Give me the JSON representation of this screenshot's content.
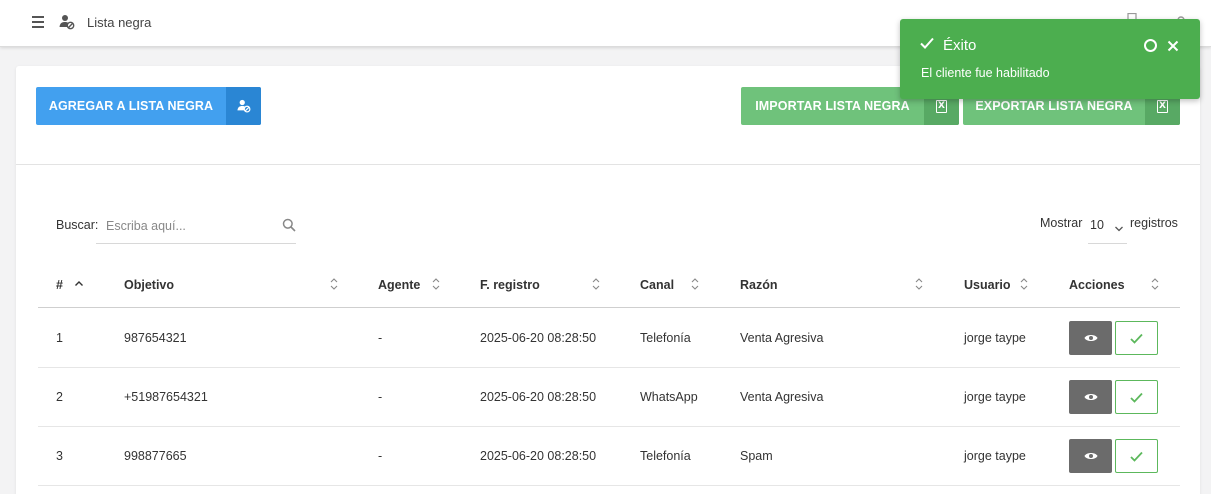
{
  "topbar": {
    "title": "Lista negra",
    "menu_icon": "hamburger-icon",
    "page_icon": "user-block-icon"
  },
  "toolbar": {
    "add_label": "AGREGAR A LISTA NEGRA",
    "import_label": "IMPORTAR LISTA NEGRA",
    "export_label": "EXPORTAR LISTA NEGRA",
    "excel_glyph": "X"
  },
  "search": {
    "label": "Buscar:",
    "placeholder": "Escriba aquí...",
    "value": ""
  },
  "length": {
    "prefix": "Mostrar",
    "value": "10",
    "suffix": "registros"
  },
  "table": {
    "columns": [
      "#",
      "Objetivo",
      "Agente",
      "F. registro",
      "Canal",
      "Razón",
      "Usuario",
      "Acciones"
    ],
    "rows": [
      {
        "n": "1",
        "objetivo": "987654321",
        "agente": "-",
        "fecha": "2025-06-20 08:28:50",
        "canal": "Telefonía",
        "razon": "Venta Agresiva",
        "usuario": "jorge taype"
      },
      {
        "n": "2",
        "objetivo": "+51987654321",
        "agente": "-",
        "fecha": "2025-06-20 08:28:50",
        "canal": "WhatsApp",
        "razon": "Venta Agresiva",
        "usuario": "jorge taype"
      },
      {
        "n": "3",
        "objetivo": "998877665",
        "agente": "-",
        "fecha": "2025-06-20 08:28:50",
        "canal": "Telefonía",
        "razon": "Spam",
        "usuario": "jorge taype"
      }
    ]
  },
  "toast": {
    "title": "Éxito",
    "message": "El cliente fue habilitado"
  },
  "colors": {
    "primary": "#42a0ef",
    "success": "#6fc27b",
    "toast": "#4cae4f",
    "view_button": "#6b6b6b"
  }
}
